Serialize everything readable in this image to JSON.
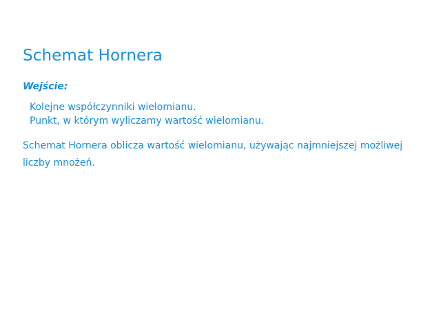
{
  "document": {
    "title": "Schemat Hornera",
    "input_label": "Wejście:",
    "inputs": [
      "Kolejne współczynniki wielomianu.",
      "Punkt, w którym wyliczamy wartość wielomianu."
    ],
    "description": "Schemat Hornera oblicza wartość wielomianu, używając najmniejszej możliwej liczby mnożeń."
  },
  "colors": {
    "text": "#1a8fd3",
    "background": "#ffffff"
  }
}
